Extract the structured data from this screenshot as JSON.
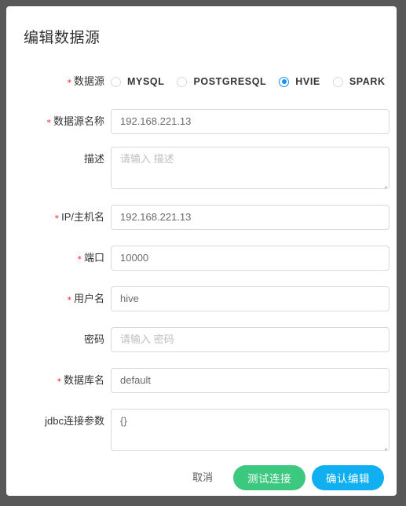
{
  "dialog": {
    "title": "编辑数据源"
  },
  "datasource_type": {
    "label": "数据源",
    "required": true,
    "options": [
      {
        "label": "MYSQL",
        "checked": false
      },
      {
        "label": "POSTGRESQL",
        "checked": false
      },
      {
        "label": "HVIE",
        "checked": true
      },
      {
        "label": "SPARK",
        "checked": false
      }
    ]
  },
  "fields": [
    {
      "label": "数据源名称",
      "required": true,
      "value": "192.168.221.13",
      "placeholder": "",
      "is_placeholder": false,
      "multiline": false
    },
    {
      "label": "描述",
      "required": false,
      "value": "请输入 描述",
      "placeholder": "请输入 描述",
      "is_placeholder": true,
      "multiline": true
    },
    {
      "label": "IP/主机名",
      "required": true,
      "value": "192.168.221.13",
      "placeholder": "",
      "is_placeholder": false,
      "multiline": false
    },
    {
      "label": "端口",
      "required": true,
      "value": "10000",
      "placeholder": "",
      "is_placeholder": false,
      "multiline": false
    },
    {
      "label": "用户名",
      "required": true,
      "value": "hive",
      "placeholder": "",
      "is_placeholder": false,
      "multiline": false
    },
    {
      "label": "密码",
      "required": false,
      "value": "请输入 密码",
      "placeholder": "请输入 密码",
      "is_placeholder": true,
      "multiline": false
    },
    {
      "label": "数据库名",
      "required": true,
      "value": "default",
      "placeholder": "",
      "is_placeholder": false,
      "multiline": false
    },
    {
      "label": "jdbc连接参数",
      "required": false,
      "value": "{}",
      "placeholder": "",
      "is_placeholder": false,
      "multiline": true
    }
  ],
  "footer": {
    "cancel_label": "取消",
    "test_label": "测试连接",
    "confirm_label": "确认编辑"
  },
  "colors": {
    "page_background": "#585858",
    "card_background": "#ffffff",
    "accent_blue": "#1890ff",
    "test_button": "#3cc87e",
    "confirm_button": "#0faff0",
    "required_asterisk": "#f5222d",
    "input_border": "#d9d9d9"
  }
}
